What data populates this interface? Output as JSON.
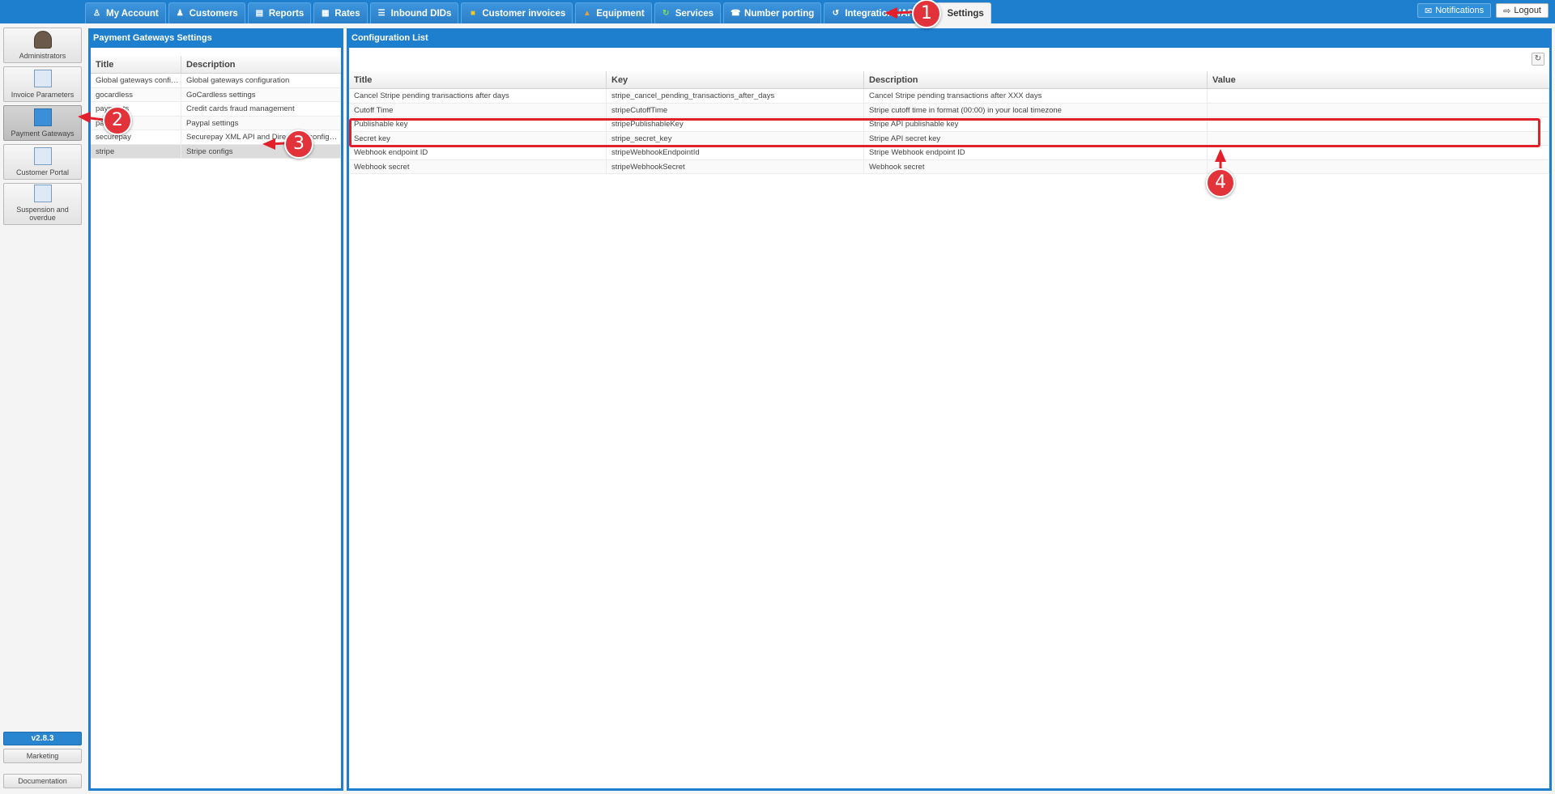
{
  "topnav": {
    "tabs": [
      {
        "label": "My Account",
        "icon": "user-icon"
      },
      {
        "label": "Customers",
        "icon": "people-icon"
      },
      {
        "label": "Reports",
        "icon": "report-icon"
      },
      {
        "label": "Rates",
        "icon": "rates-icon"
      },
      {
        "label": "Inbound DIDs",
        "icon": "list-icon"
      },
      {
        "label": "Customer invoices",
        "icon": "folder-icon"
      },
      {
        "label": "Equipment",
        "icon": "box-icon"
      },
      {
        "label": "Services",
        "icon": "refresh-icon"
      },
      {
        "label": "Number porting",
        "icon": "phone-icon"
      },
      {
        "label": "Integrations/API",
        "icon": "sync-icon"
      },
      {
        "label": "Settings",
        "icon": "gear-icon",
        "active": true
      }
    ],
    "notifications_label": "Notifications",
    "logout_label": "Logout"
  },
  "sidebar": {
    "items": [
      {
        "label": "Administrators"
      },
      {
        "label": "Invoice Parameters"
      },
      {
        "label": "Payment Gateways",
        "active": true
      },
      {
        "label": "Customer Portal"
      },
      {
        "label": "Suspension and overdue"
      }
    ],
    "version": "v2.8.3",
    "marketing_label": "Marketing",
    "documentation_label": "Documentation"
  },
  "gateways_panel": {
    "title": "Payment Gateways Settings",
    "columns": [
      "Title",
      "Description"
    ],
    "rows": [
      {
        "title": "Global gateways config...",
        "description": "Global gateways configuration"
      },
      {
        "title": "gocardless",
        "description": "GoCardless settings"
      },
      {
        "title": "payments",
        "description": "Credit cards fraud management"
      },
      {
        "title": "paypal",
        "description": "Paypal settings"
      },
      {
        "title": "securepay",
        "description": "Securepay XML API and DirectOne configurati..."
      },
      {
        "title": "stripe",
        "description": "Stripe configs",
        "selected": true
      }
    ]
  },
  "config_panel": {
    "title": "Configuration List",
    "columns": [
      "Title",
      "Key",
      "Description",
      "Value"
    ],
    "rows": [
      {
        "title": "Cancel Stripe pending transactions after days",
        "key": "stripe_cancel_pending_transactions_after_days",
        "description": "Cancel Stripe pending transactions after XXX days",
        "value": ""
      },
      {
        "title": "Cutoff Time",
        "key": "stripeCutoffTime",
        "description": "Stripe cutoff time in format (00:00) in your local timezone",
        "value": ""
      },
      {
        "title": "Publishable key",
        "key": "stripePublishableKey",
        "description": "Stripe API publishable key",
        "value": ""
      },
      {
        "title": "Secret key",
        "key": "stripe_secret_key",
        "description": "Stripe API secret key",
        "value": ""
      },
      {
        "title": "Webhook endpoint ID",
        "key": "stripeWebhookEndpointId",
        "description": "Stripe Webhook endpoint ID",
        "value": ""
      },
      {
        "title": "Webhook secret",
        "key": "stripeWebhookSecret",
        "description": "Webhook secret",
        "value": ""
      }
    ]
  },
  "annotations": [
    "1",
    "2",
    "3",
    "4"
  ],
  "colors": {
    "brand_blue": "#1e7fcf",
    "annotation_red": "#e2333b"
  }
}
